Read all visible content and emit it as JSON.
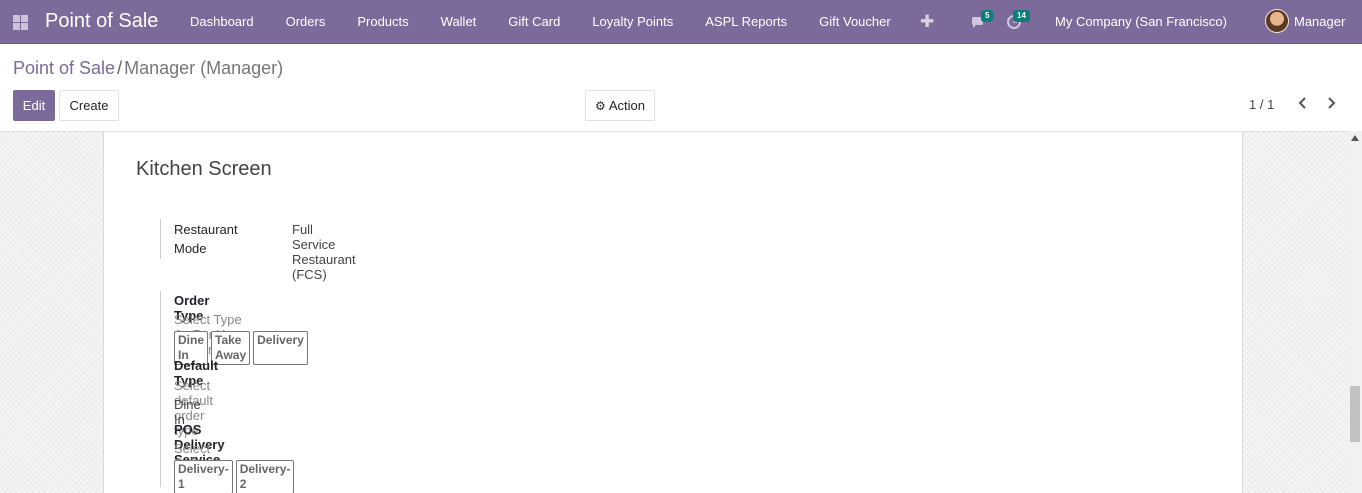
{
  "navbar": {
    "brand": "Point of Sale",
    "menu": [
      "Dashboard",
      "Orders",
      "Products",
      "Wallet",
      "Gift Card",
      "Loyalty Points",
      "ASPL Reports",
      "Gift Voucher"
    ],
    "plus": "✚",
    "messages_badge": "5",
    "activities_badge": "14",
    "company": "My Company (San Francisco)",
    "user": "Manager"
  },
  "breadcrumb": {
    "root": "Point of Sale",
    "separator": "/",
    "current": "Manager (Manager)"
  },
  "buttons": {
    "edit": "Edit",
    "create": "Create",
    "action": "Action"
  },
  "pager": {
    "value": "1 / 1",
    "prev": "‹",
    "next": "›"
  },
  "form": {
    "section_title": "Kitchen Screen",
    "restaurant_mode": {
      "label_line1": "Restaurant",
      "label_line2": "Mode",
      "value": "Full Service Restaurant (FCS)"
    },
    "order_type": {
      "label": "Order Type",
      "help": "Select Type As Per Your Requirement",
      "tags": [
        "Dine In",
        "Take Away",
        "Delivery"
      ]
    },
    "default_type": {
      "label": "Default Type",
      "help": "Select default order type",
      "value": "Dine In"
    },
    "delivery_service": {
      "label": "POS Delivery Service",
      "help": "Select Delivery Service",
      "tags": [
        "Delivery-1",
        "Delivery-2"
      ]
    }
  },
  "colors": {
    "brand_purple": "#7c6a9b",
    "badge_teal": "#0d7d77"
  }
}
